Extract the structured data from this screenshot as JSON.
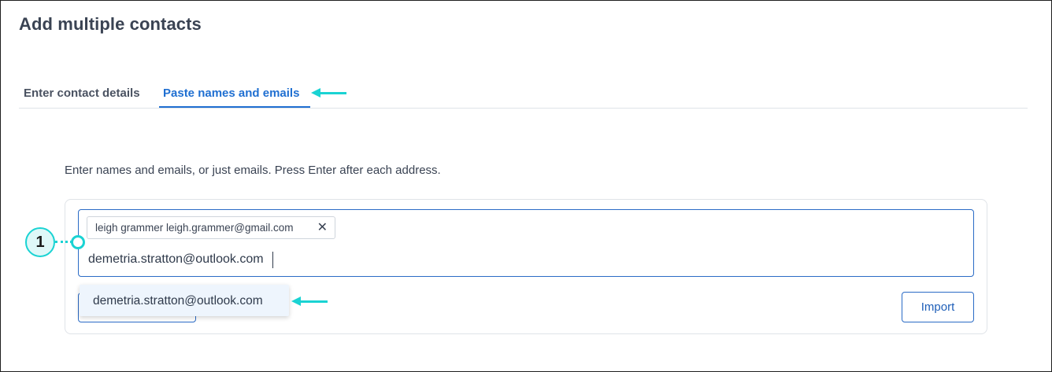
{
  "page": {
    "title": "Add multiple contacts"
  },
  "tabs": [
    {
      "label": "Enter contact details",
      "active": false
    },
    {
      "label": "Paste names and emails",
      "active": true
    }
  ],
  "instructions": "Enter names and emails, or just emails. Press Enter after each address.",
  "input": {
    "chips": [
      {
        "label": "leigh grammer leigh.grammer@gmail.com",
        "remove_icon": "✕"
      }
    ],
    "typed_value": "demetria.stratton@outlook.com"
  },
  "autocomplete": {
    "suggestion": "demetria.stratton@outlook.com"
  },
  "actions": {
    "import_label": "Import"
  },
  "callout": {
    "number": "1"
  },
  "colors": {
    "accent": "#1f6fd1",
    "annotation": "#1ad3d3",
    "border": "#2a6bc6"
  }
}
